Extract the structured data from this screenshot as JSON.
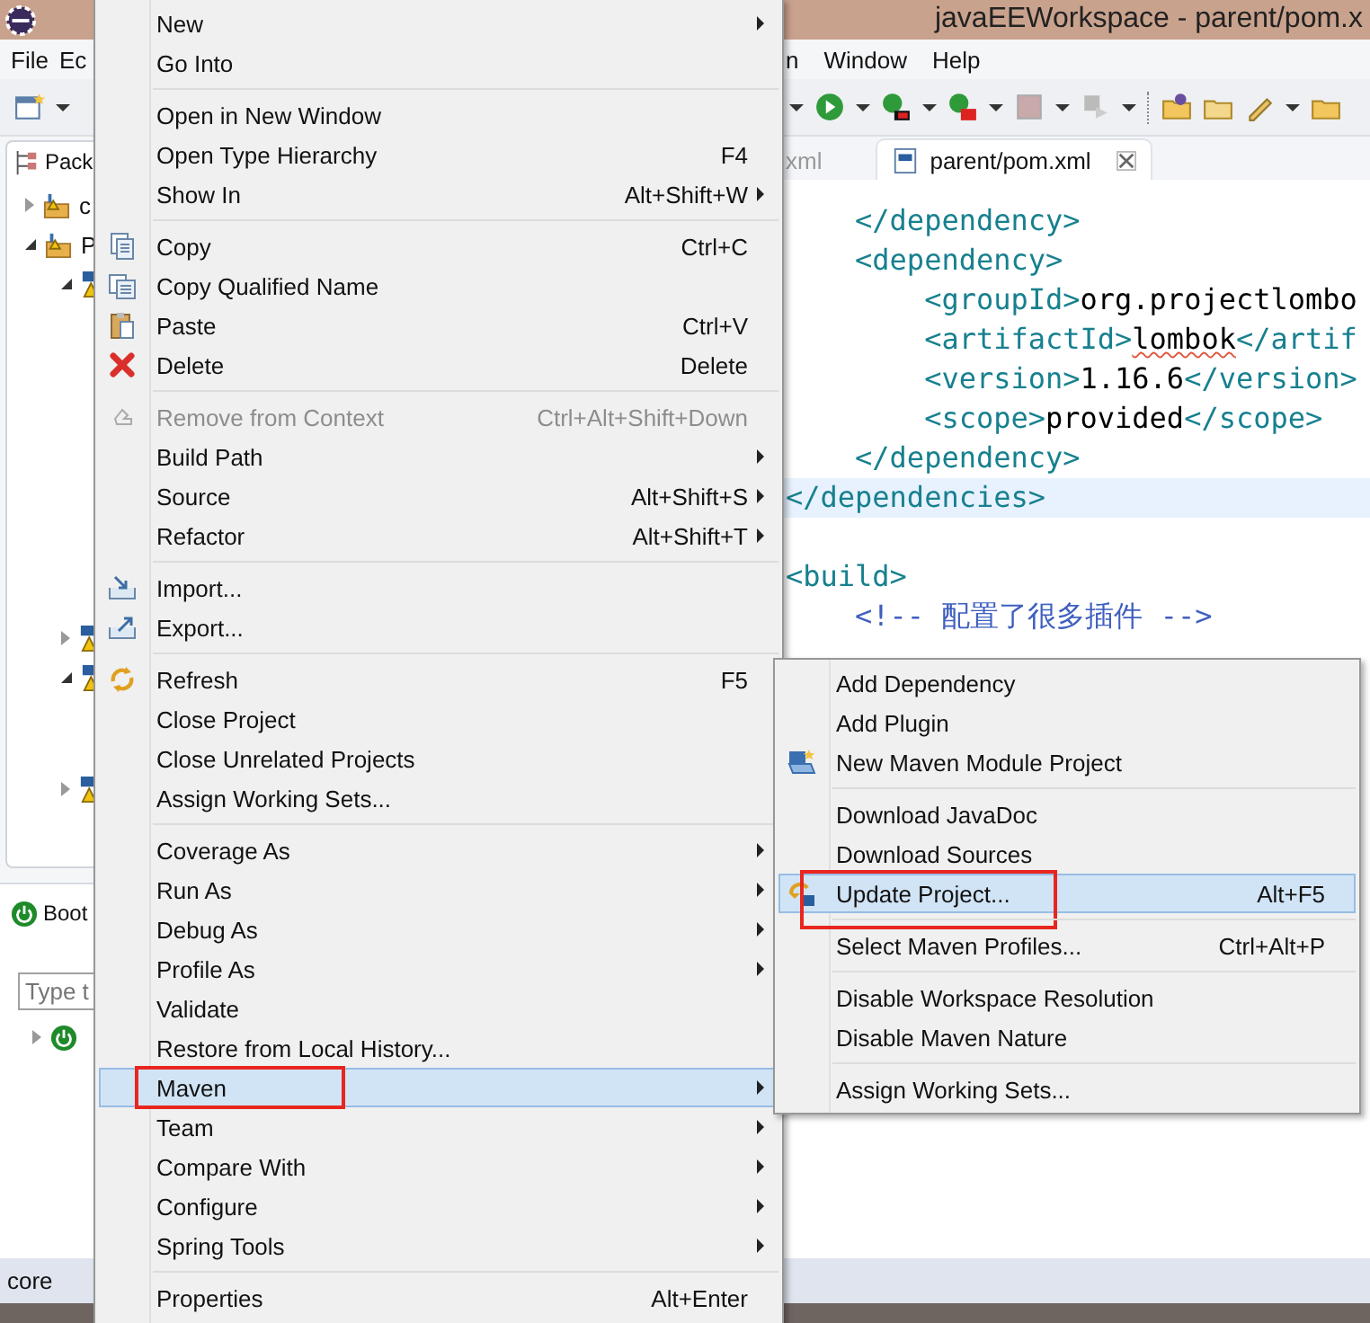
{
  "window": {
    "title": "javaEEWorkspace - parent/pom.x"
  },
  "menubar": {
    "left": [
      {
        "label": "File"
      },
      {
        "label": "Ec"
      }
    ],
    "right": [
      {
        "label": "n"
      },
      {
        "label": "Window"
      },
      {
        "label": "Help"
      }
    ]
  },
  "package_explorer": {
    "title": "Pack",
    "tree": [
      {
        "label": "c",
        "expanded": false
      },
      {
        "label": "P",
        "expanded": true,
        "children": [
          {
            "expanded": true
          },
          {
            "expanded": false
          },
          {
            "expanded": true
          },
          {
            "expanded": false
          }
        ]
      }
    ]
  },
  "boot_dashboard": {
    "title": "Boot",
    "filter": {
      "placeholder": "Type t"
    },
    "tree": [
      {
        "expanded": false
      }
    ]
  },
  "status_bar": {
    "text": "core"
  },
  "editor": {
    "tabs": [
      {
        "label": "xml",
        "selected": false
      },
      {
        "label": "parent/pom.xml",
        "selected": true
      }
    ],
    "lines": [
      {
        "current": false,
        "segments": [
          {
            "kind": "tag",
            "text": "    </dependency>"
          }
        ]
      },
      {
        "current": false,
        "segments": [
          {
            "kind": "tag",
            "text": "    <dependency>"
          }
        ]
      },
      {
        "current": false,
        "segments": [
          {
            "kind": "tag",
            "text": "        <groupId>"
          },
          {
            "kind": "text",
            "text": "org.projectlombo"
          }
        ]
      },
      {
        "current": false,
        "segments": [
          {
            "kind": "tag",
            "text": "        <artifactId>"
          },
          {
            "kind": "misspelled",
            "text": "lombok"
          },
          {
            "kind": "tag",
            "text": "</artif"
          }
        ]
      },
      {
        "current": false,
        "segments": [
          {
            "kind": "tag",
            "text": "        <version>"
          },
          {
            "kind": "text",
            "text": "1.16.6"
          },
          {
            "kind": "tag",
            "text": "</version>"
          }
        ]
      },
      {
        "current": false,
        "segments": [
          {
            "kind": "tag",
            "text": "        <scope>"
          },
          {
            "kind": "text",
            "text": "provided"
          },
          {
            "kind": "tag",
            "text": "</scope>"
          }
        ]
      },
      {
        "current": false,
        "segments": [
          {
            "kind": "tag",
            "text": "    </dependency>"
          }
        ]
      },
      {
        "current": true,
        "segments": [
          {
            "kind": "tag",
            "text": "</dependencies>"
          }
        ]
      },
      {
        "current": false
      },
      {
        "current": false,
        "segments": [
          {
            "kind": "tag",
            "text": "<build>"
          }
        ]
      },
      {
        "current": false,
        "segments": [
          {
            "kind": "comment",
            "text": "    <!-- 配置了很多插件 -->"
          }
        ]
      }
    ]
  },
  "context_menu": {
    "items": [
      {
        "kind": "item",
        "label": "New",
        "submenu": true,
        "disabled": false,
        "selected": false,
        "highlighted": false
      },
      {
        "kind": "item",
        "label": "Go Into",
        "submenu": false,
        "disabled": false,
        "selected": false,
        "highlighted": false
      },
      {
        "kind": "separator"
      },
      {
        "kind": "item",
        "label": "Open in New Window",
        "submenu": false,
        "disabled": false,
        "selected": false,
        "highlighted": false
      },
      {
        "kind": "item",
        "label": "Open Type Hierarchy",
        "shortcut": "F4",
        "submenu": false,
        "disabled": false,
        "selected": false,
        "highlighted": false
      },
      {
        "kind": "item",
        "label": "Show In",
        "shortcut": "Alt+Shift+W",
        "submenu": true,
        "disabled": false,
        "selected": false,
        "highlighted": false
      },
      {
        "kind": "separator"
      },
      {
        "kind": "item",
        "label": "Copy",
        "shortcut": "Ctrl+C",
        "submenu": false,
        "disabled": false,
        "selected": false,
        "highlighted": false
      },
      {
        "kind": "item",
        "label": "Copy Qualified Name",
        "submenu": false,
        "disabled": false,
        "selected": false,
        "highlighted": false
      },
      {
        "kind": "item",
        "label": "Paste",
        "shortcut": "Ctrl+V",
        "submenu": false,
        "disabled": false,
        "selected": false,
        "highlighted": false
      },
      {
        "kind": "item",
        "label": "Delete",
        "shortcut": "Delete",
        "submenu": false,
        "disabled": false,
        "selected": false,
        "highlighted": false
      },
      {
        "kind": "separator"
      },
      {
        "kind": "item",
        "label": "Remove from Context",
        "shortcut": "Ctrl+Alt+Shift+Down",
        "submenu": false,
        "disabled": true,
        "selected": false,
        "highlighted": false
      },
      {
        "kind": "item",
        "label": "Build Path",
        "submenu": true,
        "disabled": false,
        "selected": false,
        "highlighted": false
      },
      {
        "kind": "item",
        "label": "Source",
        "shortcut": "Alt+Shift+S",
        "submenu": true,
        "disabled": false,
        "selected": false,
        "highlighted": false
      },
      {
        "kind": "item",
        "label": "Refactor",
        "shortcut": "Alt+Shift+T",
        "submenu": true,
        "disabled": false,
        "selected": false,
        "highlighted": false
      },
      {
        "kind": "separator"
      },
      {
        "kind": "item",
        "label": "Import...",
        "submenu": false,
        "disabled": false,
        "selected": false,
        "highlighted": false
      },
      {
        "kind": "item",
        "label": "Export...",
        "submenu": false,
        "disabled": false,
        "selected": false,
        "highlighted": false
      },
      {
        "kind": "separator"
      },
      {
        "kind": "item",
        "label": "Refresh",
        "shortcut": "F5",
        "submenu": false,
        "disabled": false,
        "selected": false,
        "highlighted": false
      },
      {
        "kind": "item",
        "label": "Close Project",
        "submenu": false,
        "disabled": false,
        "selected": false,
        "highlighted": false
      },
      {
        "kind": "item",
        "label": "Close Unrelated Projects",
        "submenu": false,
        "disabled": false,
        "selected": false,
        "highlighted": false
      },
      {
        "kind": "item",
        "label": "Assign Working Sets...",
        "submenu": false,
        "disabled": false,
        "selected": false,
        "highlighted": false
      },
      {
        "kind": "separator"
      },
      {
        "kind": "item",
        "label": "Coverage As",
        "submenu": true,
        "disabled": false,
        "selected": false,
        "highlighted": false
      },
      {
        "kind": "item",
        "label": "Run As",
        "submenu": true,
        "disabled": false,
        "selected": false,
        "highlighted": false
      },
      {
        "kind": "item",
        "label": "Debug As",
        "submenu": true,
        "disabled": false,
        "selected": false,
        "highlighted": false
      },
      {
        "kind": "item",
        "label": "Profile As",
        "submenu": true,
        "disabled": false,
        "selected": false,
        "highlighted": false
      },
      {
        "kind": "item",
        "label": "Validate",
        "submenu": false,
        "disabled": false,
        "selected": false,
        "highlighted": false
      },
      {
        "kind": "item",
        "label": "Restore from Local History...",
        "submenu": false,
        "disabled": false,
        "selected": false,
        "highlighted": false
      },
      {
        "kind": "item",
        "label": "Maven",
        "submenu": true,
        "disabled": false,
        "selected": true,
        "highlighted": true
      },
      {
        "kind": "item",
        "label": "Team",
        "submenu": true,
        "disabled": false,
        "selected": false,
        "highlighted": false
      },
      {
        "kind": "item",
        "label": "Compare With",
        "submenu": true,
        "disabled": false,
        "selected": false,
        "highlighted": false
      },
      {
        "kind": "item",
        "label": "Configure",
        "submenu": true,
        "disabled": false,
        "selected": false,
        "highlighted": false
      },
      {
        "kind": "item",
        "label": "Spring Tools",
        "submenu": true,
        "disabled": false,
        "selected": false,
        "highlighted": false
      },
      {
        "kind": "separator"
      },
      {
        "kind": "item",
        "label": "Properties",
        "shortcut": "Alt+Enter",
        "submenu": false,
        "disabled": false,
        "selected": false,
        "highlighted": false
      }
    ]
  },
  "submenu": {
    "items": [
      {
        "kind": "item",
        "label": "Add Dependency",
        "submenu": false,
        "disabled": false,
        "selected": false,
        "highlighted": false
      },
      {
        "kind": "item",
        "label": "Add Plugin",
        "submenu": false,
        "disabled": false,
        "selected": false,
        "highlighted": false
      },
      {
        "kind": "item",
        "label": "New Maven Module Project",
        "submenu": false,
        "disabled": false,
        "selected": false,
        "highlighted": false
      },
      {
        "kind": "separator"
      },
      {
        "kind": "item",
        "label": "Download JavaDoc",
        "submenu": false,
        "disabled": false,
        "selected": false,
        "highlighted": false
      },
      {
        "kind": "item",
        "label": "Download Sources",
        "submenu": false,
        "disabled": false,
        "selected": false,
        "highlighted": false
      },
      {
        "kind": "item",
        "label": "Update Project...",
        "shortcut": "Alt+F5",
        "submenu": false,
        "disabled": false,
        "selected": true,
        "highlighted": true
      },
      {
        "kind": "separator"
      },
      {
        "kind": "item",
        "label": "Select Maven Profiles...",
        "shortcut": "Ctrl+Alt+P",
        "submenu": false,
        "disabled": false,
        "selected": false,
        "highlighted": false
      },
      {
        "kind": "separator"
      },
      {
        "kind": "item",
        "label": "Disable Workspace Resolution",
        "submenu": false,
        "disabled": false,
        "selected": false,
        "highlighted": false
      },
      {
        "kind": "item",
        "label": "Disable Maven Nature",
        "submenu": false,
        "disabled": false,
        "selected": false,
        "highlighted": false
      },
      {
        "kind": "separator"
      },
      {
        "kind": "item",
        "label": "Assign Working Sets...",
        "submenu": false,
        "disabled": false,
        "selected": false,
        "highlighted": false
      }
    ]
  }
}
